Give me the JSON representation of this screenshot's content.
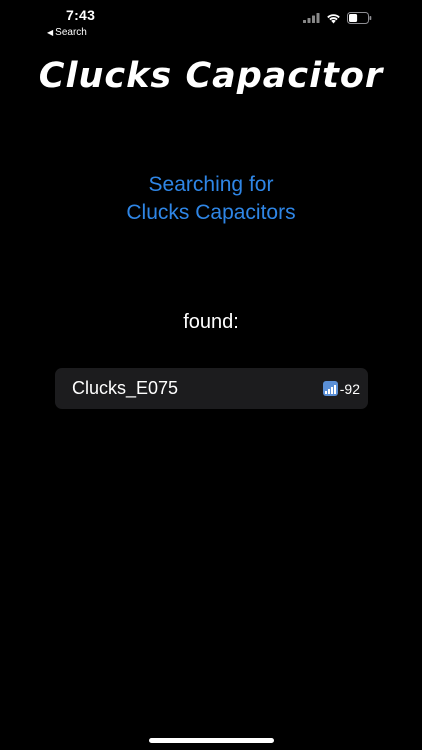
{
  "status_bar": {
    "time": "7:43",
    "back_label": "Search",
    "battery_level": 0.45
  },
  "app": {
    "title": "Clucks Capacitor"
  },
  "scan": {
    "line1": "Searching for",
    "line2": "Clucks Capacitors",
    "found_label": "found:"
  },
  "devices": [
    {
      "name": "Clucks_E075",
      "rssi": "-92"
    }
  ],
  "colors": {
    "background": "#000000",
    "accent": "#2f86e6",
    "row_bg": "#1c1c1e"
  }
}
